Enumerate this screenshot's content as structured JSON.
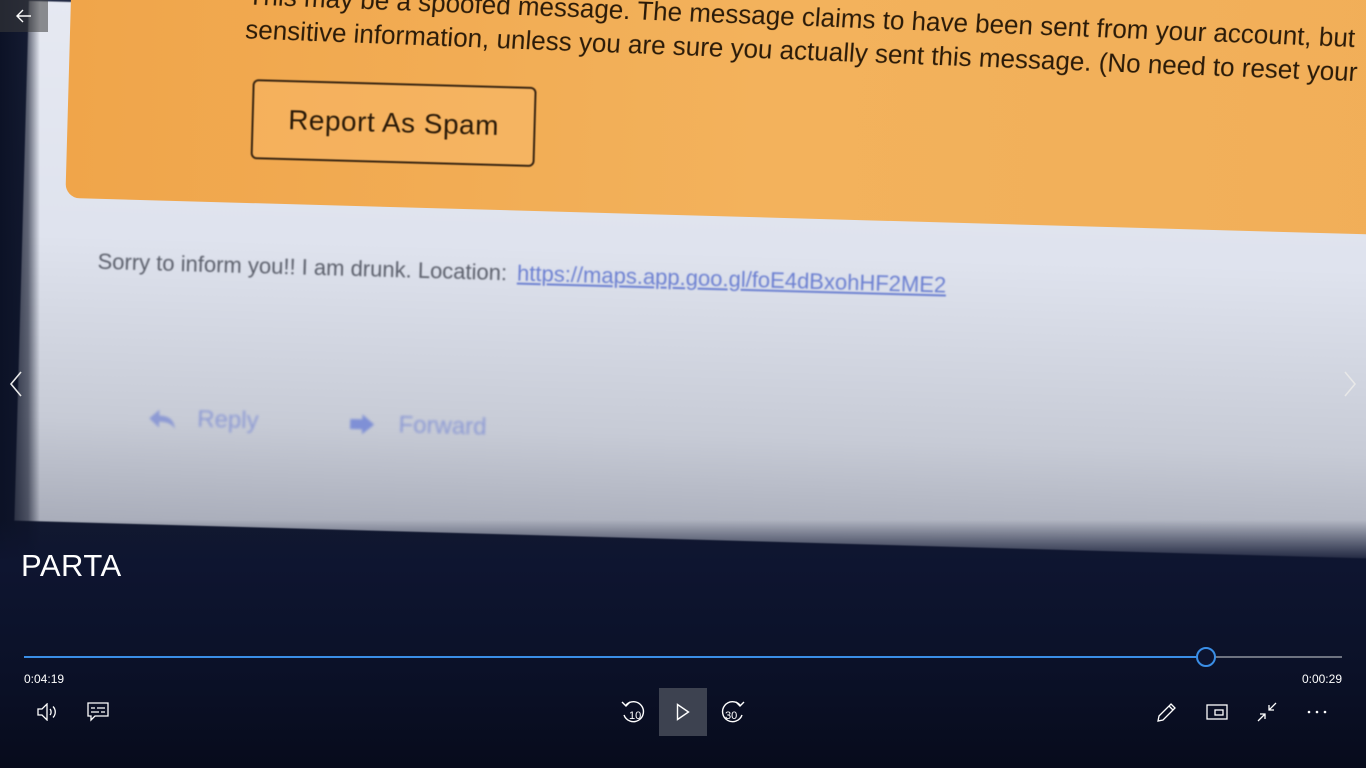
{
  "video": {
    "title": "PARTA",
    "elapsed": "0:04:19",
    "remaining": "0:00:29",
    "progress_fraction": 0.896
  },
  "frame": {
    "warning_text_line1": "This may be a spoofed message. The message claims to have been sent from your account, but",
    "warning_text_line2": "sensitive information, unless you are sure you actually sent this message. (No need to reset your",
    "spam_button": "Report As Spam",
    "message_text": "Sorry to inform you!! I am drunk. Location:",
    "message_link": "https://maps.app.goo.gl/foE4dBxohHF2ME2",
    "reply_label": "Reply",
    "forward_label": "Forward"
  },
  "controls": {
    "rewind_seconds": "10",
    "forward_seconds": "30"
  },
  "colors": {
    "accent": "#3a8ee6",
    "warning_bg": "#f2ab55",
    "chrome_bg": "#0b1226"
  },
  "icons": {
    "back": "back-arrow-icon",
    "prev": "chevron-left-icon",
    "next": "chevron-right-icon",
    "volume": "volume-icon",
    "subtitles": "subtitles-icon",
    "rewind": "rewind-10-icon",
    "play": "play-icon",
    "forward": "forward-30-icon",
    "edit": "pen-icon",
    "mini_view": "mini-view-icon",
    "exit_fullscreen": "exit-fullscreen-icon",
    "more": "more-icon"
  }
}
